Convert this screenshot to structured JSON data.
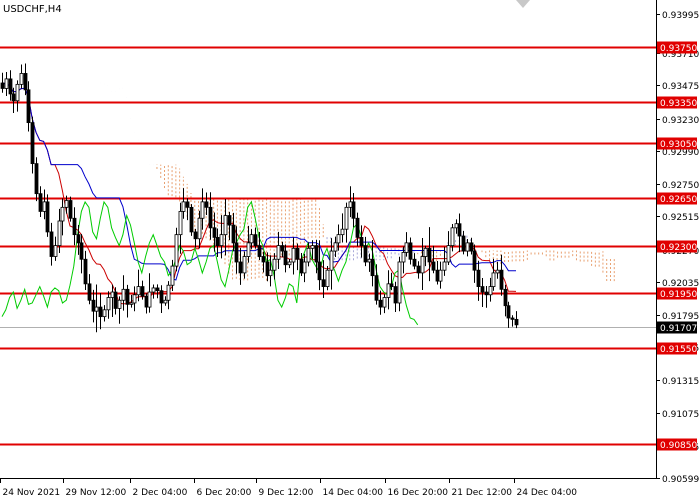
{
  "chart_data": {
    "type": "candlestick",
    "symbol_label": "USDCHF,H4",
    "y_range": [
      0.90599,
      0.1
    ],
    "ylim": [
      0.90599,
      0.93995
    ],
    "y_ticks": [
      "0.93995",
      "0.93710",
      "0.93475",
      "0.93230",
      "0.92990",
      "0.92750",
      "0.92515",
      "0.92270",
      "0.92035",
      "0.91795",
      "0.91555",
      "0.91315",
      "0.91075",
      "0.90835",
      "0.90599"
    ],
    "x_ticks": [
      "24 Nov 2021",
      "29 Nov 12:00",
      "2 Dec 04:00",
      "6 Dec 20:00",
      "9 Dec 12:00",
      "14 Dec 04:00",
      "16 Dec 20:00",
      "21 Dec 12:00",
      "24 Dec 04:00"
    ],
    "levels": [
      {
        "value": 0.9375,
        "label": "0.93750"
      },
      {
        "value": 0.9335,
        "label": "0.93350"
      },
      {
        "value": 0.9305,
        "label": "0.93050"
      },
      {
        "value": 0.9265,
        "label": "0.92650"
      },
      {
        "value": 0.923,
        "label": "0.92300"
      },
      {
        "value": 0.9195,
        "label": "0.91950"
      },
      {
        "value": 0.9155,
        "label": "0.91550"
      },
      {
        "value": 0.9085,
        "label": "0.90850"
      }
    ],
    "current_price": {
      "value": 0.91707,
      "label": "0.91707"
    },
    "colors": {
      "level_line": "#e00000",
      "candles": "#000000",
      "tenkan": "#cc0000",
      "kijun": "#0000cc",
      "chikou": "#00cc00",
      "cloud_bear": "#e8a070",
      "cloud_bull": "#a8a8d8",
      "price_tag_bg": "#000000"
    },
    "closes": [
      0.9345,
      0.9352,
      0.9341,
      0.9336,
      0.9348,
      0.9356,
      0.9344,
      0.932,
      0.929,
      0.9268,
      0.9255,
      0.9262,
      0.924,
      0.9222,
      0.923,
      0.9248,
      0.9258,
      0.9263,
      0.925,
      0.9238,
      0.9232,
      0.922,
      0.9202,
      0.919,
      0.9182,
      0.9185,
      0.9178,
      0.9183,
      0.9192,
      0.9196,
      0.9184,
      0.919,
      0.9198,
      0.9187,
      0.9188,
      0.9194,
      0.92,
      0.9193,
      0.9185,
      0.9196,
      0.9199,
      0.9197,
      0.9188,
      0.919,
      0.9201,
      0.9215,
      0.9238,
      0.9255,
      0.9262,
      0.9258,
      0.924,
      0.9235,
      0.925,
      0.9262,
      0.9258,
      0.9243,
      0.9236,
      0.923,
      0.9238,
      0.9252,
      0.9245,
      0.9232,
      0.9218,
      0.921,
      0.9222,
      0.9232,
      0.9238,
      0.923,
      0.9222,
      0.9218,
      0.9208,
      0.9212,
      0.922,
      0.923,
      0.9226,
      0.9216,
      0.9218,
      0.9228,
      0.922,
      0.921,
      0.9218,
      0.9228,
      0.923,
      0.9218,
      0.9205,
      0.92,
      0.9212,
      0.9226,
      0.9232,
      0.9238,
      0.9242,
      0.9258,
      0.9262,
      0.925,
      0.9236,
      0.923,
      0.9218,
      0.922,
      0.9208,
      0.919,
      0.9185,
      0.9192,
      0.9202,
      0.92,
      0.9188,
      0.9218,
      0.9225,
      0.9232,
      0.922,
      0.9215,
      0.921,
      0.9222,
      0.9228,
      0.9218,
      0.9212,
      0.9204,
      0.9212,
      0.9218,
      0.923,
      0.9243,
      0.9246,
      0.9237,
      0.9226,
      0.9232,
      0.9226,
      0.9212,
      0.92,
      0.9196,
      0.9194,
      0.92,
      0.921,
      0.9212,
      0.9198,
      0.9186,
      0.9177,
      0.9176,
      0.9172
    ]
  }
}
